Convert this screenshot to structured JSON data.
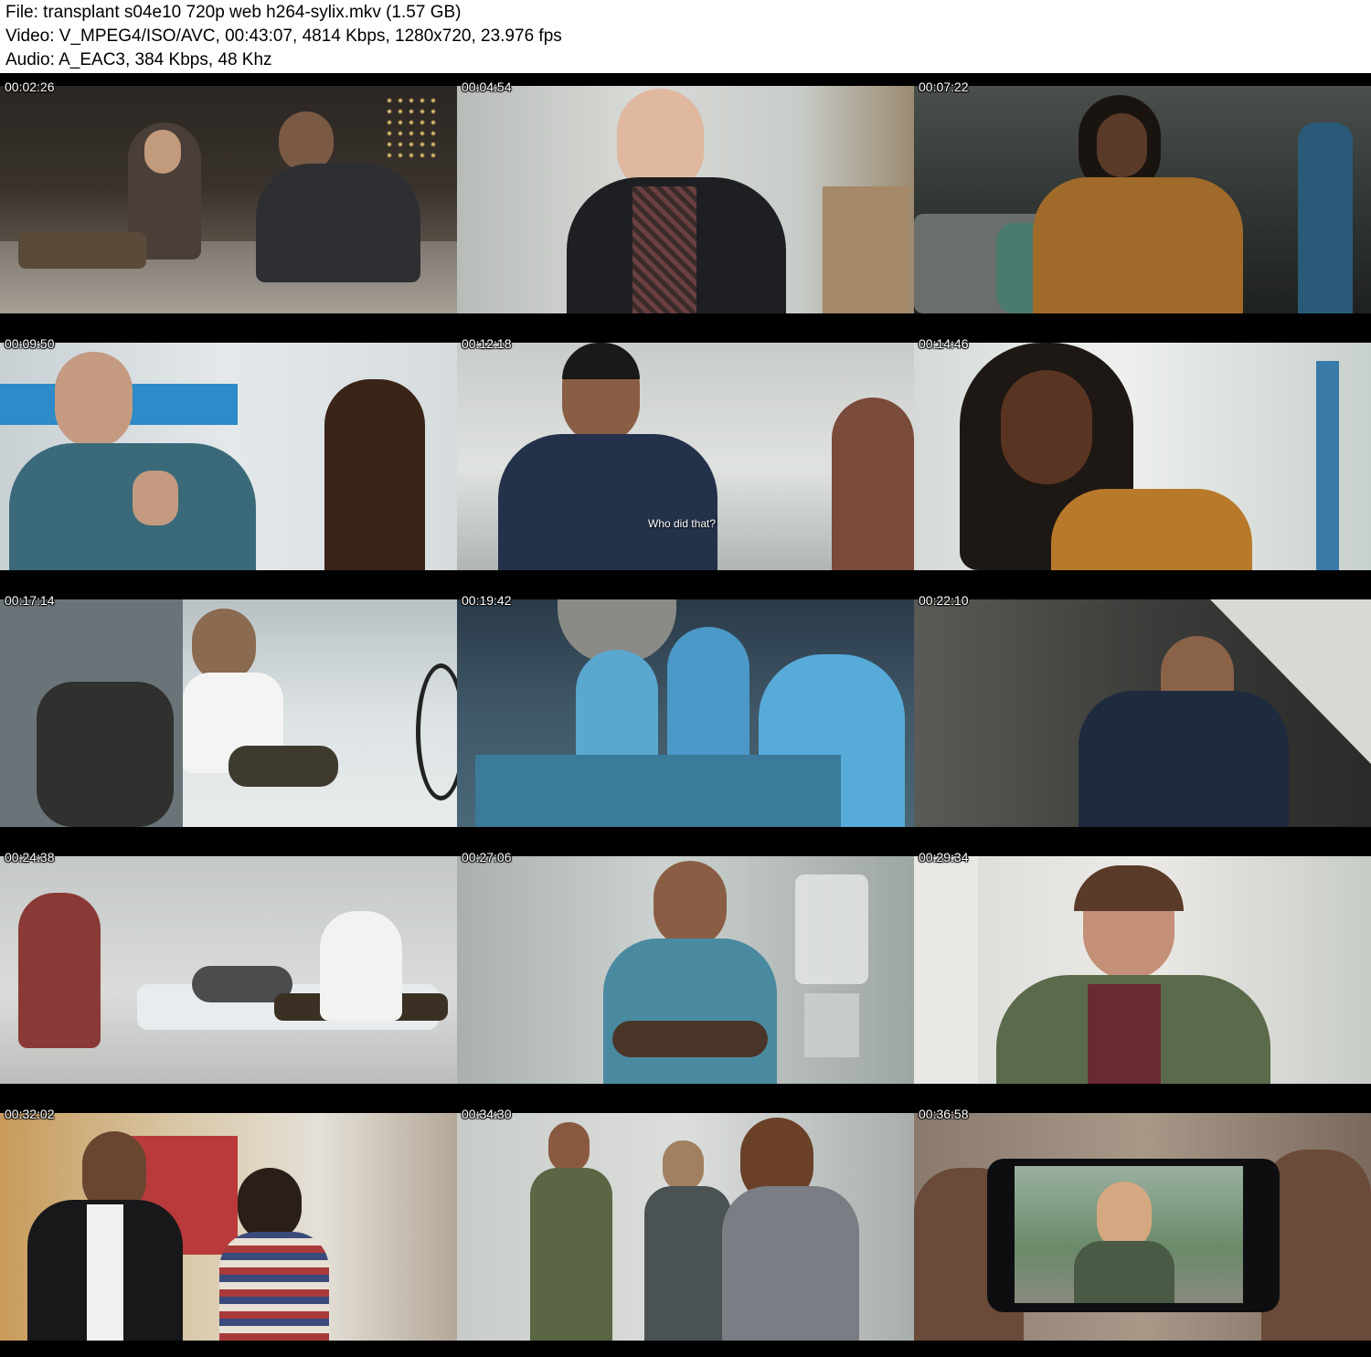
{
  "header": {
    "file_line": "File: transplant s04e10 720p web h264-sylix.mkv (1.57 GB)",
    "video_line": "Video: V_MPEG4/ISO/AVC, 00:43:07, 4814 Kbps, 1280x720, 23.976 fps",
    "audio_line": "Audio: A_EAC3, 384 Kbps, 48 Khz"
  },
  "thumbnails": [
    {
      "time": "00:02:26"
    },
    {
      "time": "00:04:54"
    },
    {
      "time": "00:07:22"
    },
    {
      "time": "00:09:50"
    },
    {
      "time": "00:12:18",
      "subtitle": "Who did that?"
    },
    {
      "time": "00:14:46"
    },
    {
      "time": "00:17:14"
    },
    {
      "time": "00:19:42"
    },
    {
      "time": "00:22:10"
    },
    {
      "time": "00:24:38"
    },
    {
      "time": "00:27:06"
    },
    {
      "time": "00:29:34"
    },
    {
      "time": "00:32:02"
    },
    {
      "time": "00:34:30"
    },
    {
      "time": "00:36:58"
    }
  ]
}
